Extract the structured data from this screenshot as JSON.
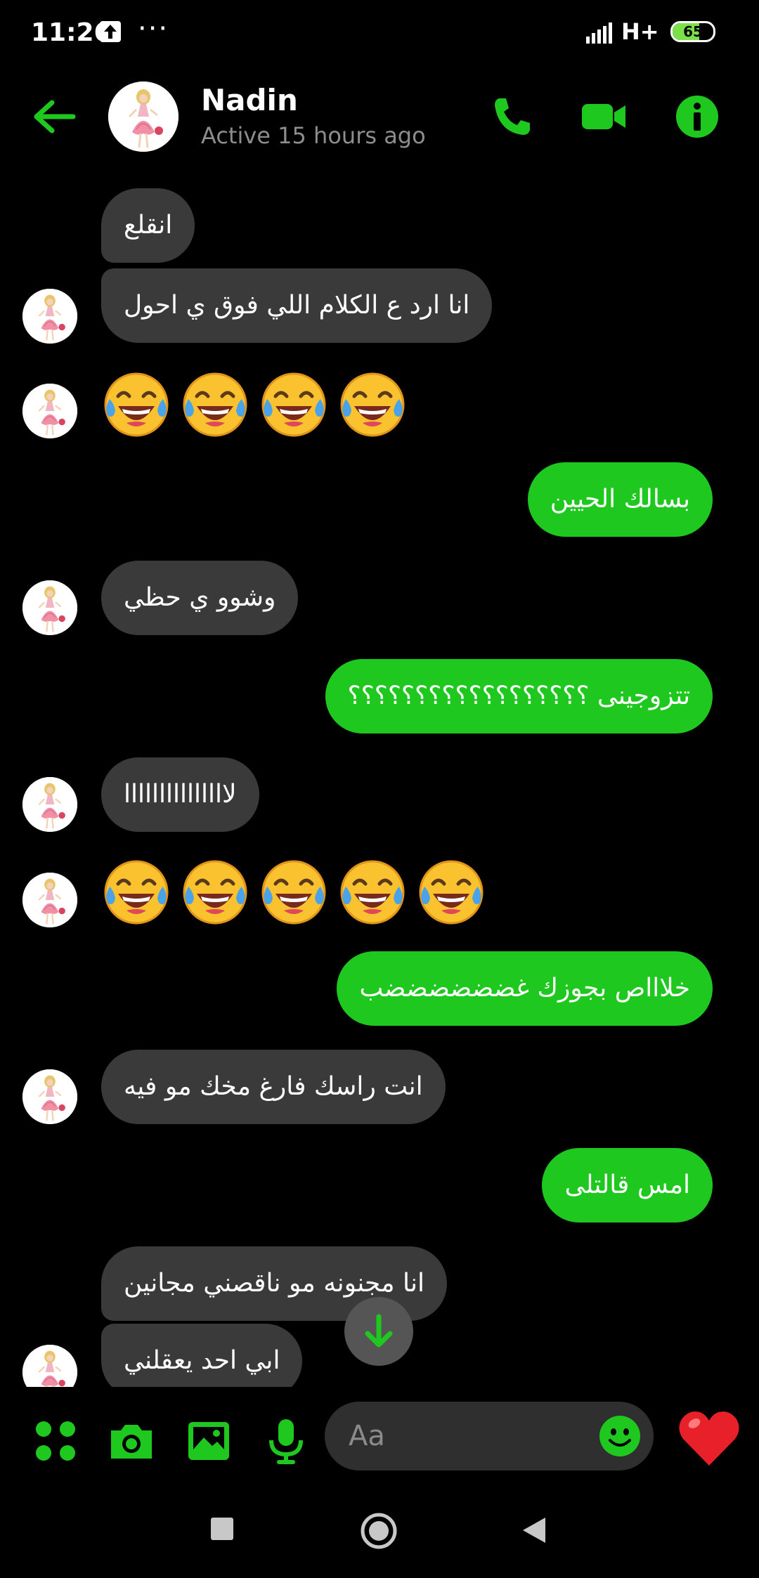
{
  "status_bar": {
    "time": "11:26",
    "dots": "···",
    "network": "H+",
    "battery": "65",
    "battery_level": 0.65
  },
  "header": {
    "contact_name": "Nadin",
    "contact_status": "Active 15 hours ago",
    "icons": [
      "back-arrow-icon",
      "phone-icon",
      "video-icon",
      "info-icon"
    ]
  },
  "messages": [
    {
      "side": "in",
      "text": "انقلع"
    },
    {
      "side": "in",
      "text": "انا ارد ع الكلام اللي فوق ي احول"
    },
    {
      "side": "in",
      "text": "😂😂😂😂",
      "emoji_count": 4
    },
    {
      "side": "out",
      "text": "بسالك الحيين"
    },
    {
      "side": "in",
      "text": "وشوو ي حظي"
    },
    {
      "side": "out",
      "text": "تتزوجينى ؟؟؟؟؟؟؟؟؟؟؟؟؟؟؟؟؟؟"
    },
    {
      "side": "in",
      "text": "لااااااااااااااا"
    },
    {
      "side": "in",
      "text": "😂😂😂😂😂",
      "emoji_count": 5
    },
    {
      "side": "out",
      "text": "خلاااص بجوزك غضضضضضضب"
    },
    {
      "side": "in",
      "text": "انت راسك فارغ مخك مو فيه"
    },
    {
      "side": "out",
      "text": "امس قالتلى"
    },
    {
      "side": "in",
      "text": "انا مجنونه مو ناقصني مجانين"
    },
    {
      "side": "in",
      "text": "ابي احد يعقلني"
    }
  ],
  "composer": {
    "placeholder": "Aa",
    "icons": [
      "apps-icon",
      "camera-icon",
      "gallery-icon",
      "microphone-icon",
      "emoji-icon",
      "heart-icon"
    ]
  },
  "colors": {
    "accent": "#1ec81e",
    "incoming_bubble": "#3a3a3a",
    "background": "#000000"
  }
}
